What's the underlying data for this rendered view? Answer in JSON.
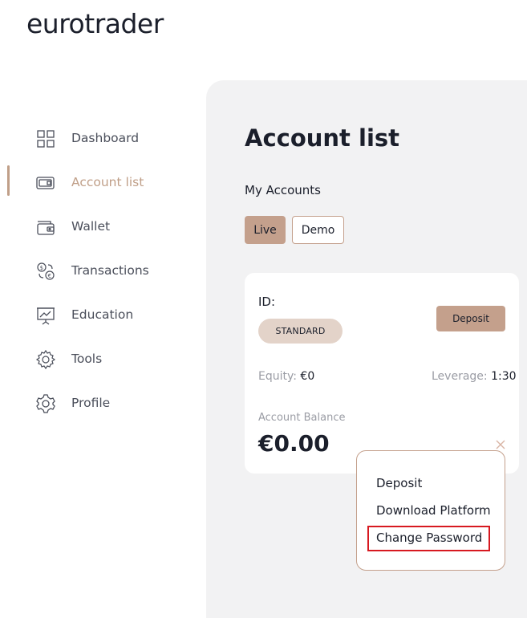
{
  "brand": {
    "logo_text": "eurotrader",
    "accent": "#c4a08c",
    "highlight": "#d71920"
  },
  "sidebar": {
    "items": [
      {
        "label": "Dashboard",
        "icon": "dashboard-grid-icon"
      },
      {
        "label": "Account list",
        "icon": "account-card-icon",
        "active": true
      },
      {
        "label": "Wallet",
        "icon": "wallet-icon"
      },
      {
        "label": "Transactions",
        "icon": "currency-exchange-icon"
      },
      {
        "label": "Education",
        "icon": "presentation-chart-icon"
      },
      {
        "label": "Tools",
        "icon": "gear-cog-icon"
      },
      {
        "label": "Profile",
        "icon": "settings-gear-icon"
      }
    ]
  },
  "main": {
    "title": "Account list",
    "section_label": "My Accounts",
    "tabs": [
      {
        "label": "Live",
        "active": true
      },
      {
        "label": "Demo",
        "active": false
      }
    ]
  },
  "account_card": {
    "id_label": "ID:",
    "type_badge": "STANDARD",
    "deposit_label": "Deposit",
    "equity_label": "Equity:",
    "equity_value": "€0",
    "leverage_label": "Leverage:",
    "leverage_value": "1:30",
    "balance_label": "Account Balance",
    "balance_value": "€0.00"
  },
  "context_menu": {
    "items": [
      {
        "label": "Deposit"
      },
      {
        "label": "Download Platform"
      },
      {
        "label": "Change Password",
        "highlighted": true
      }
    ]
  }
}
